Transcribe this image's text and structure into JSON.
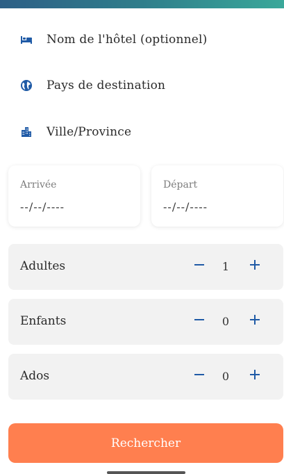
{
  "fields": {
    "hotel": {
      "label": "Nom de l'hôtel (optionnel)",
      "icon": "bed-icon"
    },
    "country": {
      "label": "Pays de destination",
      "icon": "globe-icon"
    },
    "city": {
      "label": "Ville/Province",
      "icon": "city-icon"
    }
  },
  "dates": {
    "arrival": {
      "label": "Arrivée",
      "value": "--/--/----"
    },
    "departure": {
      "label": "Départ",
      "value": "--/--/----"
    }
  },
  "counters": {
    "adults": {
      "label": "Adultes",
      "value": "1"
    },
    "children": {
      "label": "Enfants",
      "value": "0"
    },
    "teens": {
      "label": "Ados",
      "value": "0"
    }
  },
  "search_label": "Rechercher",
  "colors": {
    "accent_blue": "#1f5aa6",
    "search_button": "#ff7f4f",
    "counter_bg": "#f2f2f2"
  }
}
